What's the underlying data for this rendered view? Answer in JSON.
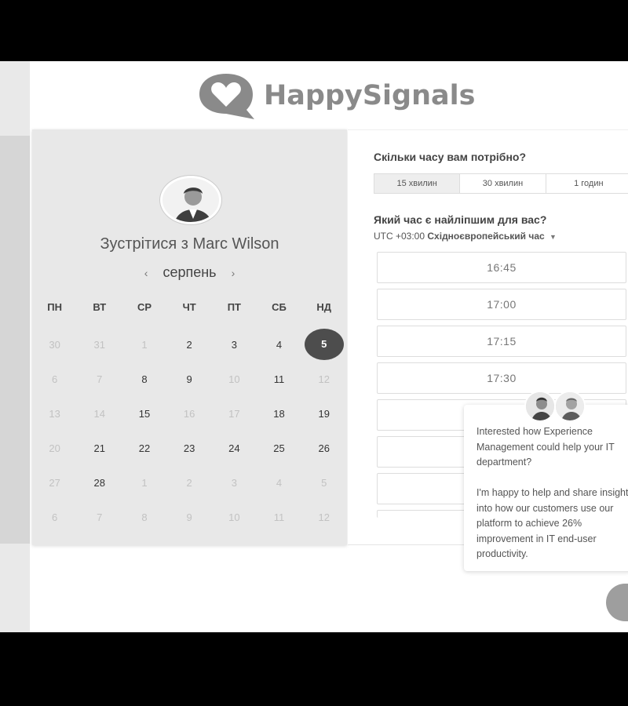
{
  "brand": {
    "name": "HappySignals"
  },
  "calendar": {
    "meet_title": "Зустрітися з Marc Wilson",
    "month": "серпень",
    "prev_icon": "chevron-left-icon",
    "next_icon": "chevron-right-icon",
    "weekdays": [
      "ПН",
      "ВТ",
      "СР",
      "ЧТ",
      "ПТ",
      "СБ",
      "НД"
    ],
    "weeks": [
      [
        {
          "d": "30",
          "s": "dim"
        },
        {
          "d": "31",
          "s": "dim"
        },
        {
          "d": "1",
          "s": "dim"
        },
        {
          "d": "2",
          "s": "avail"
        },
        {
          "d": "3",
          "s": "avail"
        },
        {
          "d": "4",
          "s": "avail"
        },
        {
          "d": "5",
          "s": "selected"
        }
      ],
      [
        {
          "d": "6",
          "s": "dim"
        },
        {
          "d": "7",
          "s": "dim"
        },
        {
          "d": "8",
          "s": "avail"
        },
        {
          "d": "9",
          "s": "avail"
        },
        {
          "d": "10",
          "s": "dim"
        },
        {
          "d": "11",
          "s": "avail"
        },
        {
          "d": "12",
          "s": "dim"
        }
      ],
      [
        {
          "d": "13",
          "s": "dim"
        },
        {
          "d": "14",
          "s": "dim"
        },
        {
          "d": "15",
          "s": "avail"
        },
        {
          "d": "16",
          "s": "dim"
        },
        {
          "d": "17",
          "s": "dim"
        },
        {
          "d": "18",
          "s": "avail"
        },
        {
          "d": "19",
          "s": "avail"
        }
      ],
      [
        {
          "d": "20",
          "s": "dim"
        },
        {
          "d": "21",
          "s": "avail"
        },
        {
          "d": "22",
          "s": "avail"
        },
        {
          "d": "23",
          "s": "avail"
        },
        {
          "d": "24",
          "s": "avail"
        },
        {
          "d": "25",
          "s": "avail"
        },
        {
          "d": "26",
          "s": "avail"
        }
      ],
      [
        {
          "d": "27",
          "s": "dim"
        },
        {
          "d": "28",
          "s": "avail"
        },
        {
          "d": "1",
          "s": "dim"
        },
        {
          "d": "2",
          "s": "dim"
        },
        {
          "d": "3",
          "s": "dim"
        },
        {
          "d": "4",
          "s": "dim"
        },
        {
          "d": "5",
          "s": "dim"
        }
      ],
      [
        {
          "d": "6",
          "s": "dim"
        },
        {
          "d": "7",
          "s": "dim"
        },
        {
          "d": "8",
          "s": "dim"
        },
        {
          "d": "9",
          "s": "dim"
        },
        {
          "d": "10",
          "s": "dim"
        },
        {
          "d": "11",
          "s": "dim"
        },
        {
          "d": "12",
          "s": "dim"
        }
      ]
    ]
  },
  "booking": {
    "duration_question": "Скільки часу вам потрібно?",
    "durations": [
      "15 хвилин",
      "30 хвилин",
      "1 годин"
    ],
    "selected_duration": "15 хвилин",
    "time_question": "Який час є найліпшим для вас?",
    "tz_offset": "UTC +03:00",
    "tz_name": "Східноєвропейський час",
    "slots": [
      "16:45",
      "17:00",
      "17:15",
      "17:30",
      "",
      "",
      "",
      ""
    ]
  },
  "chat": {
    "message_1": "Interested how Experience Management could help your IT department?",
    "message_2": "I'm happy to help and share insight into how our customers use our platform to achieve 26% improvement in IT end-user productivity."
  }
}
